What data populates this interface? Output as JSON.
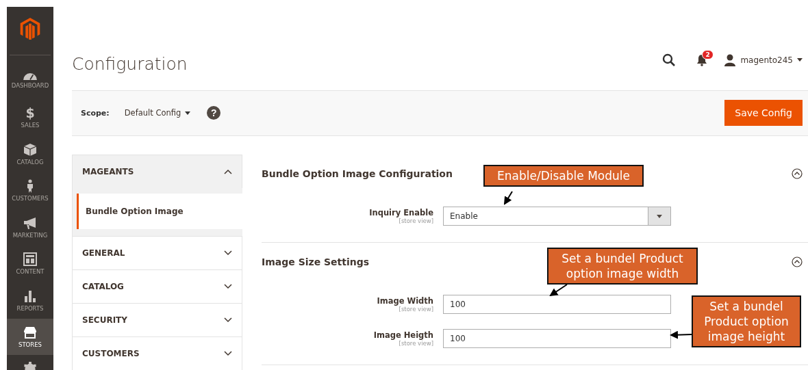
{
  "sidebar": {
    "items": [
      {
        "label": "DASHBOARD",
        "selected": false
      },
      {
        "label": "SALES",
        "selected": false,
        "glyph": "$"
      },
      {
        "label": "CATALOG",
        "selected": false
      },
      {
        "label": "CUSTOMERS",
        "selected": false
      },
      {
        "label": "MARKETING",
        "selected": false
      },
      {
        "label": "CONTENT",
        "selected": false
      },
      {
        "label": "REPORTS",
        "selected": false
      },
      {
        "label": "STORES",
        "selected": true
      }
    ]
  },
  "header": {
    "title": "Configuration",
    "notifications": "2",
    "user": "magento245"
  },
  "scope": {
    "label": "Scope:",
    "value": "Default Config",
    "help": "?",
    "button": "Save Config"
  },
  "nav": [
    {
      "label": "MAGEANTS",
      "expanded": true,
      "children": [
        {
          "label": "Bundle Option Image",
          "selected": true
        }
      ]
    },
    {
      "label": "GENERAL",
      "expanded": false
    },
    {
      "label": "CATALOG",
      "expanded": false
    },
    {
      "label": "SECURITY",
      "expanded": false
    },
    {
      "label": "CUSTOMERS",
      "expanded": false
    }
  ],
  "sections": [
    {
      "title": "Bundle Option Image Configuration",
      "fields": [
        {
          "kind": "select",
          "label": "Inquiry Enable",
          "scope": "[store view]",
          "value": "Enable"
        }
      ]
    },
    {
      "title": "Image Size Settings",
      "fields": [
        {
          "kind": "text",
          "label": "Image Width",
          "scope": "[store view]",
          "value": "100"
        },
        {
          "kind": "text",
          "label": "Image Heigth",
          "scope": "[store view]",
          "value": "100"
        }
      ]
    }
  ],
  "annotations": [
    {
      "lines": [
        "Enable/Disable Module"
      ]
    },
    {
      "lines": [
        "Set a bundel Product",
        "option image width"
      ]
    },
    {
      "lines": [
        "Set a bundel",
        "Product option",
        "image height"
      ]
    }
  ]
}
